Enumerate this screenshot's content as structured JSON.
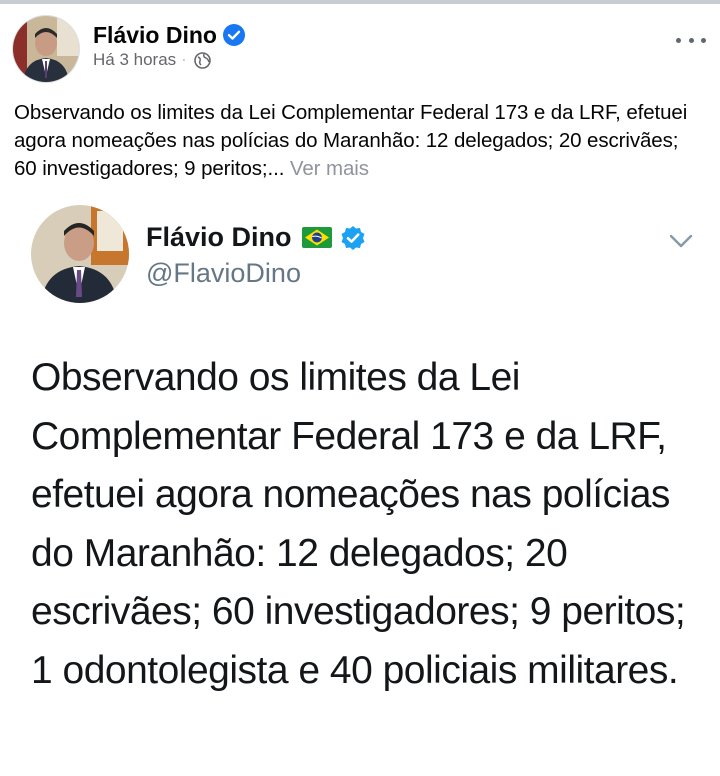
{
  "post": {
    "author": "Flávio Dino",
    "time": "Há 3 horas",
    "separator": "·",
    "text": "Observando os limites da Lei Complementar Federal 173 e da LRF, efetuei agora nomeações nas polícias do Maranhão: 12 delegados; 20 escrivães; 60 investigadores; 9 peritos;...",
    "see_more": "Ver mais"
  },
  "tweet": {
    "name": "Flávio Dino",
    "handle": "@FlavioDino",
    "text": "Observando os limites da Lei Complementar Federal 173 e da LRF, efetuei agora nomeações nas polícias do Maranhão: 12 delegados; 20 escrivães; 60 investigadores; 9 peritos; 1 odontolegista e 40 policiais militares."
  },
  "icons": {
    "verified": "verified-badge-icon",
    "audience": "globe-icon",
    "more": "more-options-icon",
    "flag": "brazil-flag-icon",
    "chevron": "chevron-down-icon"
  },
  "colors": {
    "fb_verified": "#1877f2",
    "tw_verified": "#1da1f2",
    "meta_gray": "#65676b",
    "handle_gray": "#657786"
  }
}
